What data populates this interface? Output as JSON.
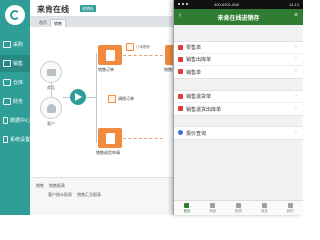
{
  "desktop": {
    "app_title": "来肯在线",
    "tag": "进销存",
    "tabs": [
      {
        "label": "首页"
      },
      {
        "label": "销售"
      }
    ],
    "sidebar": {
      "items": [
        {
          "label": "采购"
        },
        {
          "label": "销售"
        },
        {
          "label": "仓库"
        },
        {
          "label": "财务"
        },
        {
          "label": "数据中心"
        },
        {
          "label": "系统设置"
        }
      ]
    },
    "flow": {
      "goods_label": "商品",
      "customer_label": "客户",
      "node1_label": "销售订单",
      "node1_sub": "订单跟踪",
      "node2_label": "销售出库单",
      "node3_label": "销售退货申请",
      "mid_label": "调拨订单",
      "side_label": "销售"
    },
    "footer": {
      "row1": [
        "销售",
        "销售报表"
      ],
      "row2": [
        "客户统计报表",
        "销售汇总报表"
      ]
    }
  },
  "phone": {
    "status": {
      "phone_number": "400-6901-608",
      "time": "14:13"
    },
    "title": "来肯在线进销存",
    "back_symbol": "‹",
    "close_symbol": "×",
    "groups": [
      {
        "items": [
          {
            "label": "零售单",
            "icon": "retail-icon",
            "color": "#e53935"
          },
          {
            "label": "销售出库单",
            "icon": "sales-out-icon",
            "color": "#e53935"
          },
          {
            "label": "销售单",
            "icon": "sales-icon",
            "color": "#e53935"
          }
        ]
      },
      {
        "items": [
          {
            "label": "销售退货单",
            "icon": "return-icon",
            "color": "#e53935"
          },
          {
            "label": "销售退货出库单",
            "icon": "return-out-icon",
            "color": "#e53935"
          }
        ]
      },
      {
        "items": [
          {
            "label": "报价查询",
            "icon": "search-icon",
            "color": "#3f6fd8"
          }
        ]
      }
    ],
    "nav": [
      {
        "label": "首页",
        "active": true
      },
      {
        "label": "商品",
        "active": false
      },
      {
        "label": "报表",
        "active": false
      },
      {
        "label": "消息",
        "active": false
      },
      {
        "label": "我的",
        "active": false
      }
    ],
    "arrow_symbol": "›"
  },
  "colors": {
    "sidebar": "#2f9e97",
    "phone_title": "#2e7d32",
    "accent_orange": "#f08a3c"
  }
}
